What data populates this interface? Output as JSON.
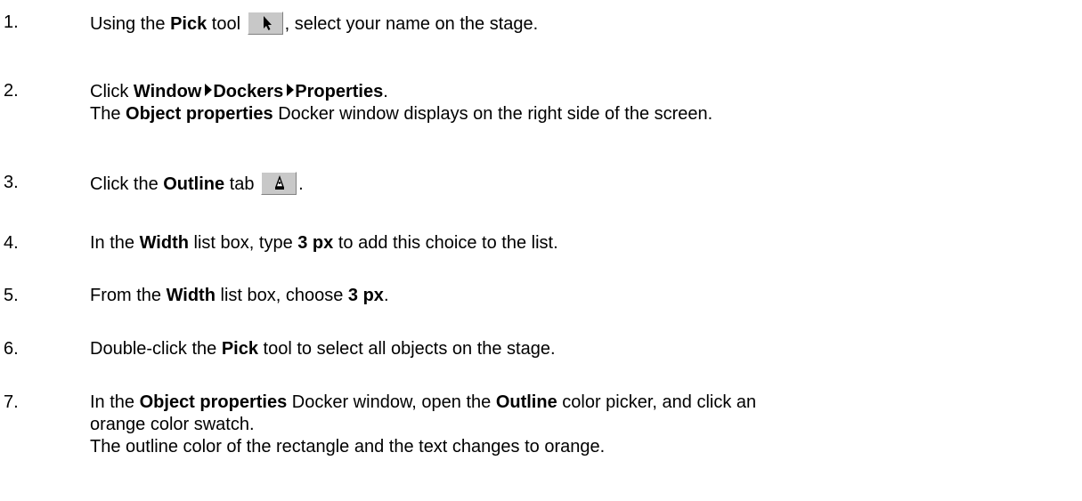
{
  "steps": [
    {
      "num": "1.",
      "text_a": "Using the ",
      "b1": "Pick",
      "text_b": " tool ",
      "icon": "pick-arrow-icon",
      "text_c": ", select your name on the stage."
    },
    {
      "num": "2.",
      "text_a": "Click ",
      "b1": "Window",
      "b2": "Dockers",
      "b3": "Properties",
      "text_b": ".",
      "sub_b": "Object properties",
      "sub_text": " Docker window displays on the right side of the screen.",
      "sub_pre": "The "
    },
    {
      "num": "3.",
      "text_a": "Click the ",
      "b1": "Outline",
      "text_b": " tab ",
      "icon": "outline-pen-icon",
      "text_c": "."
    },
    {
      "num": "4.",
      "text_a": "In the ",
      "b1": "Width",
      "text_b": " list box, type ",
      "b2": "3 px",
      "text_c": " to add this choice to the list."
    },
    {
      "num": "5.",
      "text_a": "From the ",
      "b1": "Width",
      "text_b": " list box, choose ",
      "b2": "3 px",
      "text_c": "."
    },
    {
      "num": "6.",
      "text_a": "Double-click the ",
      "b1": "Pick",
      "text_b": " tool to select all objects on the stage."
    },
    {
      "num": "7.",
      "text_a": "In the ",
      "b1": "Object properties",
      "text_b": " Docker window, open the ",
      "b2": "Outline",
      "text_c": " color picker, and click an",
      "line2": "orange color swatch.",
      "line3": "The outline color of the rectangle and the text changes to orange."
    }
  ],
  "colors": {
    "text": "#000000",
    "icon_bg": "#c8c8c8"
  }
}
